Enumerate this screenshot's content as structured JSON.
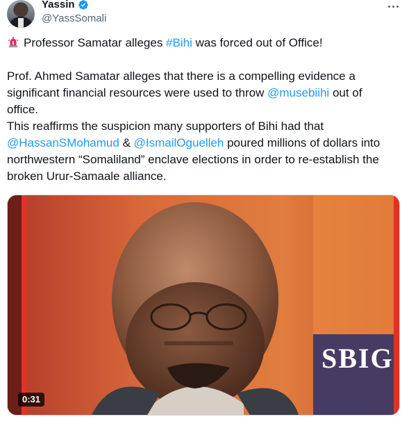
{
  "author": {
    "display_name": "Yassin",
    "handle": "@YassSomali",
    "verified_icon": "verified-badge-icon",
    "verified_color": "#1d9bf0"
  },
  "tweet": {
    "line1_text": "Professor Samatar alleges ",
    "line1_link": "#Bihi",
    "line1_tail": " was forced out of Office!",
    "para1_a": "Prof. Ahmed Samatar alleges that there is a compelling evidence a significant financial resources were used to throw ",
    "para1_link": "@musebiihi",
    "para1_b": " out of office.",
    "para2_a": "This reaffirms the suspicion many supporters of Bihi had that ",
    "para2_link1": "@HassanSMohamud",
    "para2_amp": " & ",
    "para2_link2": "@IsmailOguelleh",
    "para2_b": " poured millions of dollars into northwestern  “Somaliland” enclave elections in order to re-establish the broken Urur-Samaale alliance.",
    "link_color": "#1d9bf0"
  },
  "media": {
    "duration": "0:31",
    "background_text": "SBIG"
  }
}
